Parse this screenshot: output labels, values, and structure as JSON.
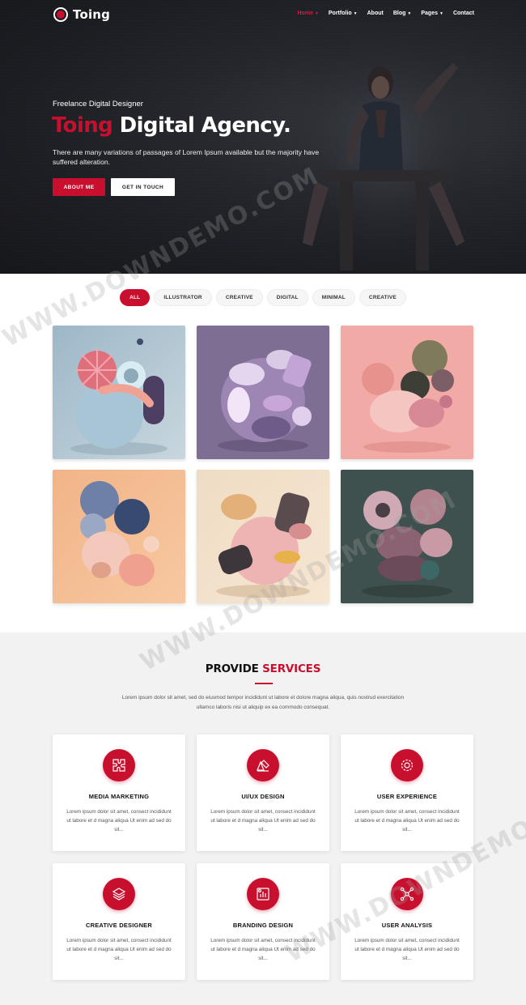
{
  "brand": {
    "name": "Toing",
    "accent": "#c8102e"
  },
  "nav": {
    "items": [
      {
        "label": "Home",
        "caret": true
      },
      {
        "label": "Portfolio",
        "caret": true
      },
      {
        "label": "About",
        "caret": false
      },
      {
        "label": "Blog",
        "caret": true
      },
      {
        "label": "Pages",
        "caret": true
      },
      {
        "label": "Contact",
        "caret": false
      }
    ]
  },
  "hero": {
    "subtitle": "Freelance Digital Designer",
    "title_accent": "Toing",
    "title_rest": " Digital Agency.",
    "description": "There are many variations of passages of Lorem Ipsum available but the majority have suffered alteration.",
    "primary_button": "ABOUT ME",
    "secondary_button": "GET IN TOUCH"
  },
  "filters": [
    "ALL",
    "ILLUSTRATOR",
    "CREATIVE",
    "DIGITAL",
    "MINIMAL",
    "CREATIVE"
  ],
  "services": {
    "title_plain": "PROVIDE ",
    "title_accent": "SERVICES",
    "description": "Lorem ipsum dolor sit amet, sed do eiusmod tempor incididunt ut labore et dolore magna aliqua, quis nostrud exercitation ullamco laboris nisi ut aliquip ex ea commodo consequat.",
    "cards": [
      {
        "title": "MEDIA MARKETING",
        "icon": "puzzle-icon",
        "text": "Lorem ipsum dolor sit amet, consect incididunt ut labore et d magna aliqua Ut enim ad sed do sit..."
      },
      {
        "title": "UI/UX DESIGN",
        "icon": "design-tools-icon",
        "text": "Lorem ipsum dolor sit amet, consect incididunt ut labore et d magna aliqua Ut enim ad sed do sit..."
      },
      {
        "title": "USER EXPERIENCE",
        "icon": "gear-icon",
        "text": "Lorem ipsum dolor sit amet, consect incididunt ut labore et d magna aliqua Ut enim ad sed do sit..."
      },
      {
        "title": "CREATIVE DESIGNER",
        "icon": "layers-icon",
        "text": "Lorem ipsum dolor sit amet, consect incididunt ut labore et d magna aliqua Ut enim ad sed do sit..."
      },
      {
        "title": "BRANDING DESIGN",
        "icon": "analytics-icon",
        "text": "Lorem ipsum dolor sit amet, consect incididunt ut labore et d magna aliqua Ut enim ad sed do sit..."
      },
      {
        "title": "USER ANALYSIS",
        "icon": "network-icon",
        "text": "Lorem ipsum dolor sit amet, consect incididunt ut labore et d magna aliqua Ut enim ad sed do sit..."
      }
    ]
  },
  "watermark": "WWW.DOWNDEMO.COM"
}
